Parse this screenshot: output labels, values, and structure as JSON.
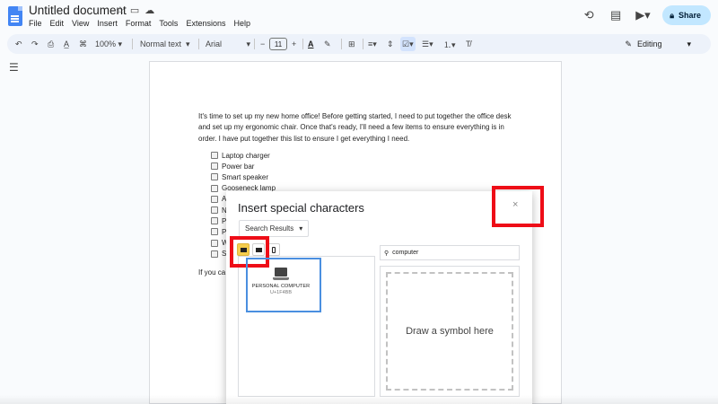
{
  "header": {
    "title": "Untitled document",
    "menus": [
      "File",
      "Edit",
      "View",
      "Insert",
      "Format",
      "Tools",
      "Extensions",
      "Help"
    ],
    "share_label": "Share"
  },
  "toolbar": {
    "zoom": "100%",
    "style": "Normal text",
    "font": "Arial",
    "font_size": "11",
    "mode": "Editing"
  },
  "document": {
    "paragraph": "It's time to set up my new home office! Before getting started, I need to put together the office desk and set up my ergonomic chair. Once that's ready, I'll need a few items to ensure everything is in order. I have put together this list to ensure I get everything I need.",
    "checklist": [
      "Laptop charger",
      "Power bar",
      "Smart speaker",
      "Gooseneck lamp",
      "A",
      "N",
      "P",
      "P",
      "W",
      "S"
    ],
    "trailing_text": "If you ca"
  },
  "dialog": {
    "title": "Insert special characters",
    "close_glyph": "×",
    "category": "Search Results",
    "search_value": "computer",
    "result": {
      "name": "PERSONAL COMPUTER",
      "code": "U+1F4BB"
    },
    "draw_placeholder": "Draw a symbol here"
  },
  "colors": {
    "annotation_red": "#ee0d17",
    "annotation_blue": "#4a8fe0",
    "share_bg": "#c2e7ff",
    "selected_tab": "#f5cd4d",
    "doc_icon": "#4285f4"
  }
}
